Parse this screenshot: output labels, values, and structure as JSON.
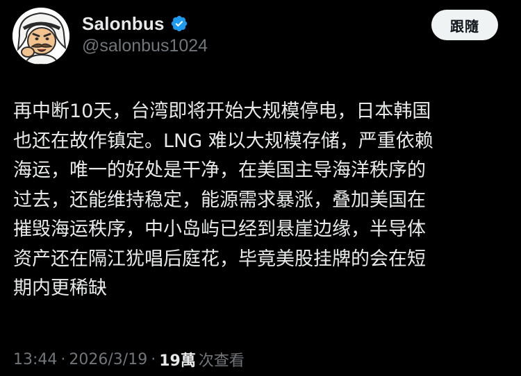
{
  "user": {
    "display_name": "Salonbus",
    "handle": "@salonbus1024",
    "verified": true,
    "verified_color": "#1d9bf0"
  },
  "follow_button": {
    "label": "跟隨"
  },
  "tweet": {
    "lines": [
      "再中断10天，台湾即将开始大规模停电，日本韩国",
      "也还在故作镇定。LNG 难以大规模存储，严重依赖",
      "海运，唯一的好处是干净，在美国主导海洋秩序的",
      "过去，还能维持稳定，能源需求暴涨，叠加美国在",
      "摧毁海运秩序，中小岛屿已经到悬崖边缘，半导体",
      "资产还在隔江犹唱后庭花，毕竟美股挂牌的会在短",
      "期内更稀缺"
    ]
  },
  "meta": {
    "time": "13:44",
    "separator": "·",
    "date": "2026/3/19",
    "views_count": "19萬",
    "views_label": "次查看"
  },
  "colors": {
    "background": "#000000",
    "primary_text": "#e7e9ea",
    "secondary_text": "#71767b",
    "button_bg": "#eff3f4",
    "button_text": "#0f1419"
  },
  "icons": {
    "avatar": "cartoon-character-avatar",
    "verified": "verified-badge-icon"
  }
}
